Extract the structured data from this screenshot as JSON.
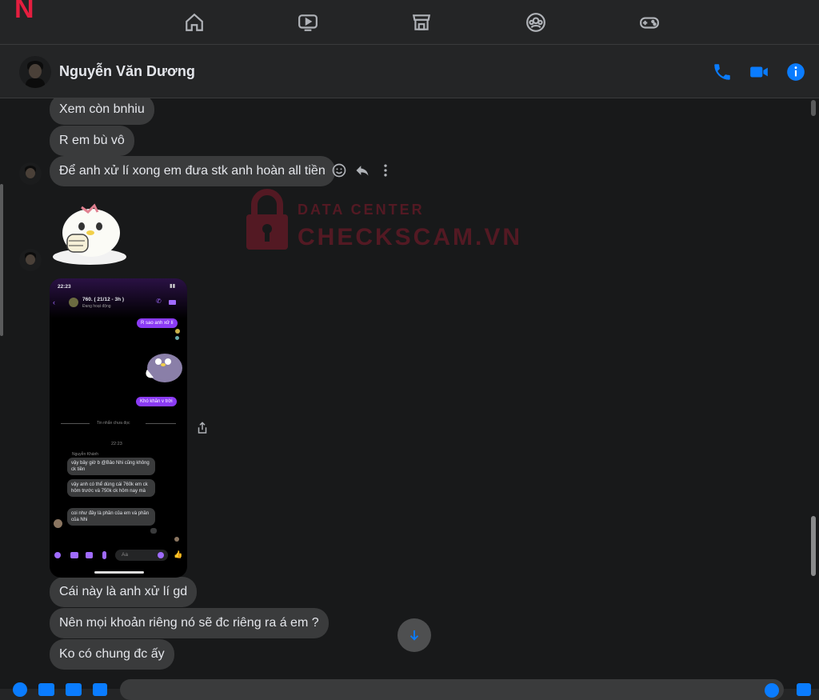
{
  "topnav": {
    "brand": "N",
    "icons": [
      "home-icon",
      "watch-icon",
      "marketplace-icon",
      "groups-icon",
      "gaming-icon"
    ]
  },
  "header": {
    "name": "Nguyễn Văn Dương",
    "icons": [
      "phone-icon",
      "video-call-icon",
      "info-icon"
    ],
    "accent": "#0a7cff"
  },
  "messages": [
    {
      "text": "Xem còn bnhiu"
    },
    {
      "text": "R em bù vô"
    },
    {
      "text": "Để anh xử lí xong em đưa stk anh hoàn all tiền"
    },
    {
      "text": "Cái này là anh xử lí gd"
    },
    {
      "text": "Nên mọi khoản riêng nó sẽ đc riêng ra á em ?"
    },
    {
      "text": "Ko có chung đc ấy"
    }
  ],
  "watermark": {
    "line1": "DATA CENTER",
    "line2": "CHECKSCAM.VN"
  },
  "screenshot": {
    "time": "22:23",
    "title": "760. ( 21/12 - 3h )",
    "status": "Đang hoạt động",
    "sent": [
      "R sao anh xử lí",
      "Khó khăn v trời"
    ],
    "unread_divider": "Tin nhắn chưa đọc",
    "time2": "22:23",
    "sender": "Nguyễn Khánh",
    "received": [
      "vậy bây giờ b @Bảo Nhi cũng không ck tiền",
      "vậy anh có thể dùng cái 760k em ck hôm trước và 750k ck hôm nay mà",
      "coi như đây là phần của em và phần của Nhi"
    ],
    "composer_placeholder": "Aa"
  },
  "colors": {
    "bg": "#18191a",
    "bubble": "#3a3b3c",
    "brand": "#e41e3f",
    "purple": "#8b3bf5"
  }
}
